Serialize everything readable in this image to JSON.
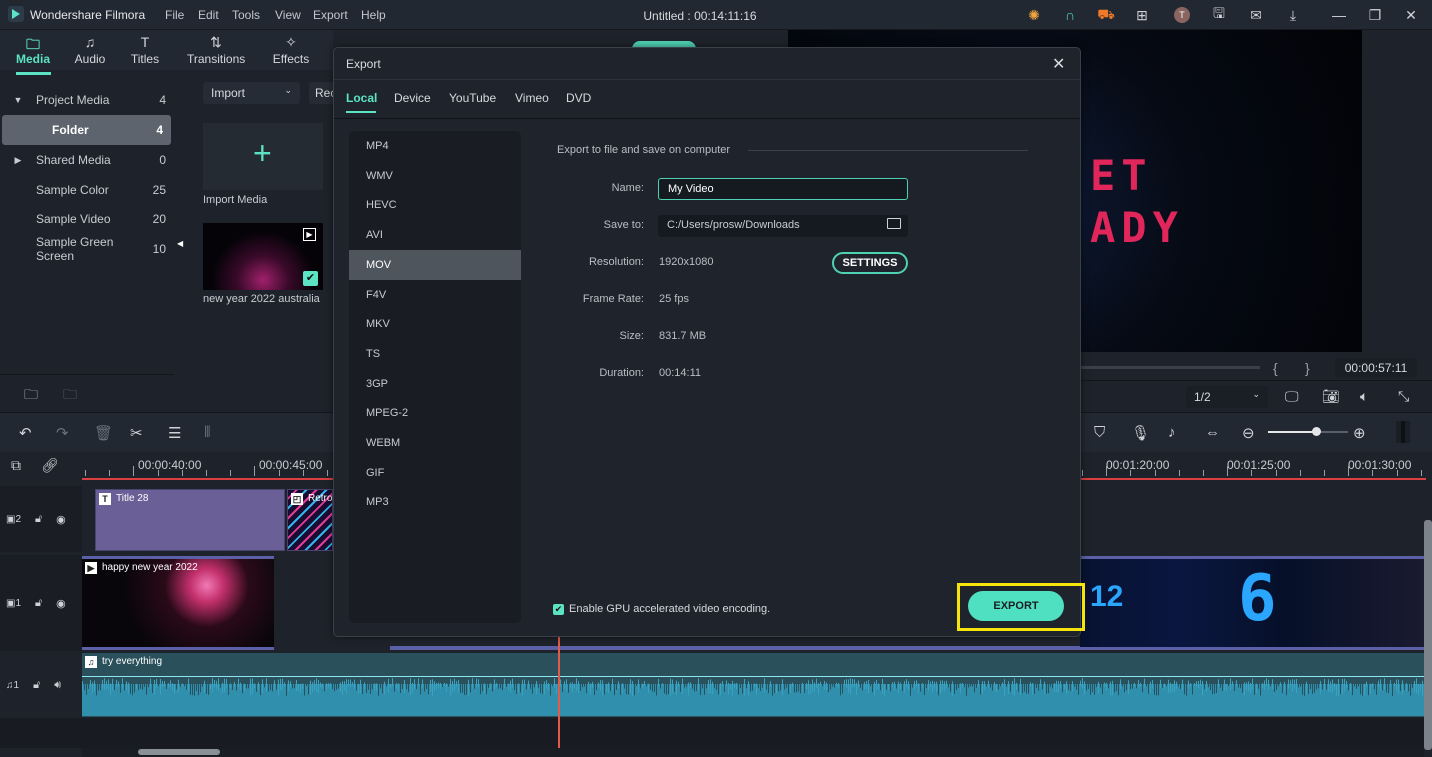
{
  "app": {
    "name": "Wondershare Filmora",
    "window_title": "Untitled : 00:14:11:16",
    "menu": [
      "File",
      "Edit",
      "Tools",
      "View",
      "Export",
      "Help"
    ],
    "title_icons": [
      "lightbulb-icon",
      "headset-icon",
      "cart-icon",
      "gift-icon",
      "avatar",
      "save-icon",
      "mail-icon",
      "download-icon"
    ],
    "avatar_letter": "T",
    "window_controls": [
      "minimize",
      "restore",
      "close"
    ]
  },
  "tool_tabs": [
    {
      "label": "Media",
      "icon": "folder-icon",
      "active": true
    },
    {
      "label": "Audio",
      "icon": "music-icon"
    },
    {
      "label": "Titles",
      "icon": "titles-icon"
    },
    {
      "label": "Transitions",
      "icon": "transitions-icon"
    },
    {
      "label": "Effects",
      "icon": "effects-icon"
    }
  ],
  "media_library": {
    "items": [
      {
        "label": "Project Media",
        "count": "4",
        "expanded": true
      },
      {
        "label": "Folder",
        "count": "4",
        "selected": true
      },
      {
        "label": "Shared Media",
        "count": "0",
        "expanded": false
      },
      {
        "label": "Sample Color",
        "count": "25"
      },
      {
        "label": "Sample Video",
        "count": "20"
      },
      {
        "label": "Sample Green Screen",
        "count": "10"
      }
    ],
    "import_dropdown": "Import",
    "record_dropdown": "Rec",
    "import_media_label": "Import Media",
    "clip_label": "new year 2022 australia"
  },
  "preview": {
    "overlay_text_line1": "ET",
    "overlay_text_line2": "ADY",
    "timecode": "00:00:57:11",
    "ratio": "1/2"
  },
  "timeline": {
    "ruler_labels": [
      "00:00:40:00",
      "00:00:45:00",
      "00:01:20:00",
      "00:01:25:00",
      "00:01:30:00"
    ],
    "tracks": [
      {
        "id": "video2",
        "label": "2"
      },
      {
        "id": "video1",
        "label": "1"
      },
      {
        "id": "audio1",
        "label": "1"
      }
    ],
    "clips": {
      "title": "Title 28",
      "retro": "Retro",
      "video": "happy new year 2022",
      "audio": "try everything",
      "countdown_12": "12",
      "countdown_6": "6"
    },
    "zoom_level": 0.6
  },
  "export_dialog": {
    "title": "Export",
    "tabs": [
      {
        "label": "Local",
        "active": true
      },
      {
        "label": "Device"
      },
      {
        "label": "YouTube"
      },
      {
        "label": "Vimeo"
      },
      {
        "label": "DVD"
      }
    ],
    "formats": [
      "MP4",
      "WMV",
      "HEVC",
      "AVI",
      "MOV",
      "F4V",
      "MKV",
      "TS",
      "3GP",
      "MPEG-2",
      "WEBM",
      "GIF",
      "MP3"
    ],
    "selected_format": "MOV",
    "section_title": "Export to file and save on computer",
    "fields": {
      "name_label": "Name:",
      "name_value": "My Video",
      "save_label": "Save to:",
      "save_value": "C:/Users/prosw/Downloads",
      "resolution_label": "Resolution:",
      "resolution_value": "1920x1080",
      "framerate_label": "Frame Rate:",
      "framerate_value": "25 fps",
      "size_label": "Size:",
      "size_value": "831.7 MB",
      "duration_label": "Duration:",
      "duration_value": "00:14:11"
    },
    "settings_button": "SETTINGS",
    "gpu_label": "Enable GPU accelerated video encoding.",
    "gpu_checked": true,
    "export_button": "EXPORT",
    "highlight_color": "#f5e50a",
    "accent_color": "#5be3c4"
  }
}
